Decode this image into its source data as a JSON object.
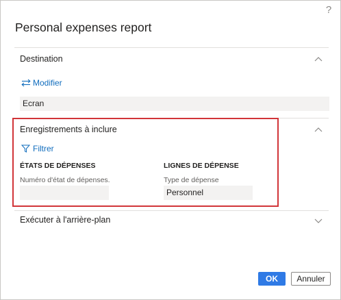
{
  "dialog": {
    "title": "Personal expenses report",
    "help_icon": "question-mark-icon",
    "help_glyph": "?"
  },
  "destination": {
    "title": "Destination",
    "chevron": "chevron-up-icon",
    "modify_label": "Modifier",
    "modify_icon": "swap-arrows-icon",
    "value": "Ecran"
  },
  "records": {
    "title": "Enregistrements à inclure",
    "chevron": "chevron-up-icon",
    "filter_label": "Filtrer",
    "filter_icon": "filter-icon",
    "expense_reports": {
      "heading": "ÉTATS DE DÉPENSES",
      "field_label": "Numéro d'état de dépenses.",
      "field_value": ""
    },
    "expense_lines": {
      "heading": "LIGNES DE DÉPENSE",
      "field_label": "Type de dépense",
      "field_value": "Personnel"
    },
    "highlight_color": "#d13438"
  },
  "background": {
    "title": "Exécuter à l'arrière-plan",
    "chevron": "chevron-down-icon"
  },
  "footer": {
    "ok_label": "OK",
    "cancel_label": "Annuler",
    "accent_color": "#2f7ae5"
  }
}
